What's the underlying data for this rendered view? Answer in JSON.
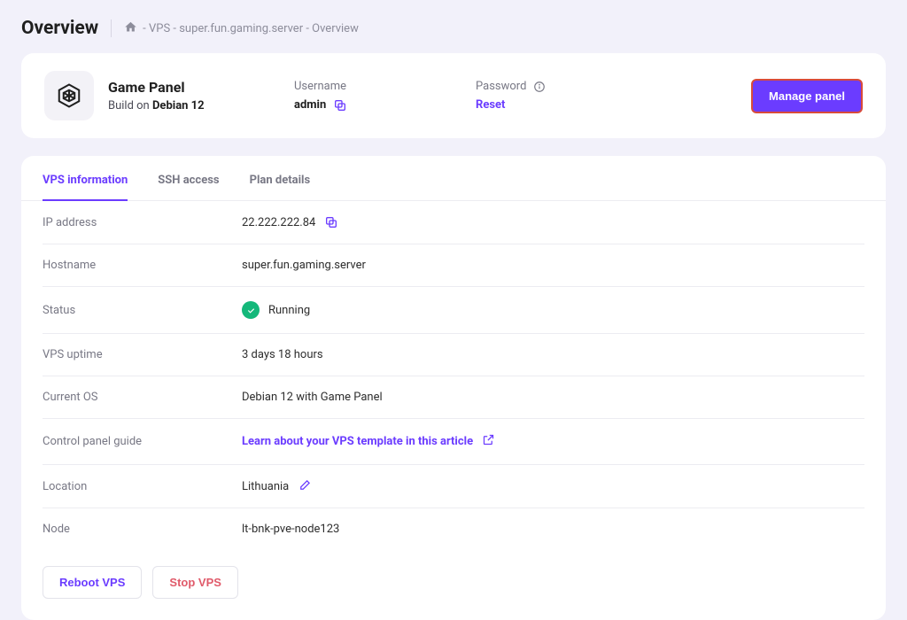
{
  "header": {
    "title": "Overview",
    "breadcrumb": " - VPS - super.fun.gaming.server - Overview"
  },
  "panel": {
    "name": "Game Panel",
    "build_prefix": "Build on ",
    "build_os": "Debian 12",
    "username_label": "Username",
    "username_value": "admin",
    "password_label": "Password",
    "reset_label": "Reset",
    "manage_label": "Manage panel"
  },
  "tabs": {
    "active": "VPS information",
    "ssh": "SSH access",
    "plan": "Plan details"
  },
  "info": {
    "ip_label": "IP address",
    "ip_value": "22.222.222.84",
    "hostname_label": "Hostname",
    "hostname_value": "super.fun.gaming.server",
    "status_label": "Status",
    "status_value": "Running",
    "uptime_label": "VPS uptime",
    "uptime_value": "3 days 18 hours",
    "os_label": "Current OS",
    "os_value": "Debian 12 with Game Panel",
    "guide_label": "Control panel guide",
    "guide_link": "Learn about your VPS template in this article",
    "location_label": "Location",
    "location_value": "Lithuania",
    "node_label": "Node",
    "node_value": "lt-bnk-pve-node123"
  },
  "actions": {
    "reboot": "Reboot VPS",
    "stop": "Stop VPS"
  }
}
